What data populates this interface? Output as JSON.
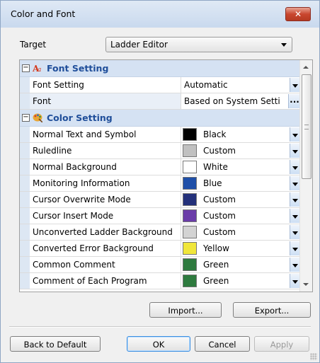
{
  "dialog": {
    "title": "Color and Font",
    "close_label": "✕"
  },
  "target": {
    "label": "Target",
    "value": "Ladder Editor"
  },
  "font_category": {
    "label": "Font Setting",
    "toggle": "⊟"
  },
  "font_rows": [
    {
      "name": "Font Setting",
      "value": "Automatic"
    },
    {
      "name": "Font",
      "value": "Based on System Setti"
    }
  ],
  "color_category": {
    "label": "Color Setting",
    "toggle": "⊟"
  },
  "color_rows": [
    {
      "name": "Normal Text and Symbol",
      "value": "Black",
      "color": "#000000"
    },
    {
      "name": "Ruledline",
      "value": "Custom",
      "color": "#c0c0c0"
    },
    {
      "name": "Normal Background",
      "value": "White",
      "color": "#ffffff"
    },
    {
      "name": "Monitoring Information",
      "value": "Blue",
      "color": "#1f4fa8"
    },
    {
      "name": "Cursor Overwrite Mode",
      "value": "Custom",
      "color": "#23307a"
    },
    {
      "name": "Cursor Insert Mode",
      "value": "Custom",
      "color": "#6a3ca8"
    },
    {
      "name": "Unconverted Ladder Background",
      "value": "Custom",
      "color": "#d3d3d3"
    },
    {
      "name": "Converted Error Background",
      "value": "Yellow",
      "color": "#f0e63a"
    },
    {
      "name": "Common Comment",
      "value": "Green",
      "color": "#2d7a3e"
    },
    {
      "name": "Comment of Each Program",
      "value": "Green",
      "color": "#2d7a3e"
    }
  ],
  "buttons": {
    "import": "Import...",
    "export": "Export...",
    "back_to_default": "Back to Default",
    "ok": "OK",
    "cancel": "Cancel",
    "apply": "Apply"
  },
  "dots_label": "..."
}
